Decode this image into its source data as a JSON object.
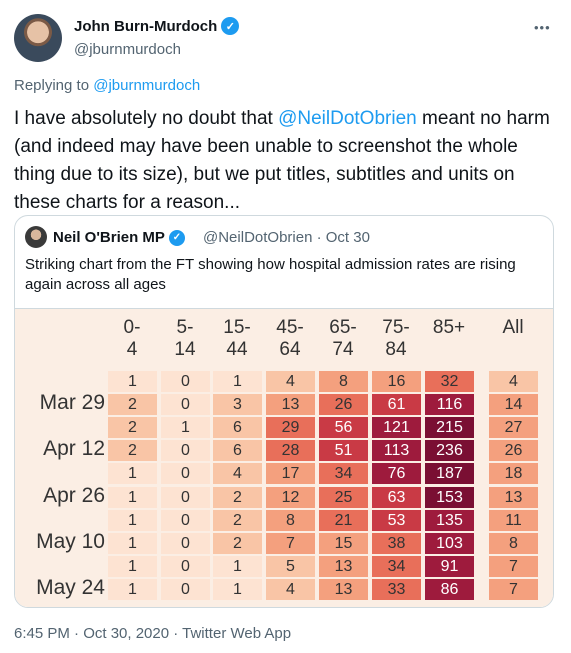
{
  "author": {
    "name": "John Burn-Murdoch",
    "handle": "@jburnmurdoch",
    "verified_icon": "✓"
  },
  "more_icon": "•••",
  "replying": {
    "prefix": "Replying to ",
    "handle": "@jburnmurdoch"
  },
  "tweet": {
    "text_before": "I have absolutely no doubt that ",
    "mention": "@NeilDotObrien",
    "text_after": " meant no harm (and indeed may have been unable to screenshot the whole thing due to its size), but we put titles, subtitles and units on these charts for a reason..."
  },
  "quote": {
    "name": "Neil O'Brien MP",
    "verified_icon": "✓",
    "meta": "@NeilDotObrien · Oct 30",
    "text": "Striking chart from the FT showing how hospital admission rates are rising again across all ages"
  },
  "chart_data": {
    "type": "heatmap",
    "columns": [
      "0-\n4",
      "5-\n14",
      "15-\n44",
      "45-\n64",
      "65-\n74",
      "75-\n84",
      "85+",
      "All"
    ],
    "row_labels": [
      "Mar 29",
      "Apr 12",
      "Apr 26",
      "May 10",
      "May 24"
    ],
    "rows": [
      [
        1,
        0,
        1,
        4,
        8,
        16,
        32,
        4
      ],
      [
        2,
        0,
        3,
        13,
        26,
        61,
        116,
        14
      ],
      [
        2,
        1,
        6,
        29,
        56,
        121,
        215,
        27
      ],
      [
        2,
        0,
        6,
        28,
        51,
        113,
        236,
        26
      ],
      [
        1,
        0,
        4,
        17,
        34,
        76,
        187,
        18
      ],
      [
        1,
        0,
        2,
        12,
        25,
        63,
        153,
        13
      ],
      [
        1,
        0,
        2,
        8,
        21,
        53,
        135,
        11
      ],
      [
        1,
        0,
        2,
        7,
        15,
        38,
        103,
        8
      ],
      [
        1,
        0,
        1,
        5,
        13,
        34,
        91,
        7
      ],
      [
        1,
        0,
        1,
        4,
        13,
        33,
        86,
        7
      ]
    ],
    "label_rows": [
      1,
      3,
      5,
      7,
      9
    ],
    "colors": {
      "scale": [
        "#fde3d2",
        "#f9c5a6",
        "#f4a07e",
        "#e86f5a",
        "#c93a45",
        "#9e1b3d",
        "#7a0f33"
      ],
      "background": "#fbeee4"
    }
  },
  "timestamp": "6:45 PM · Oct 30, 2020 · Twitter Web App"
}
